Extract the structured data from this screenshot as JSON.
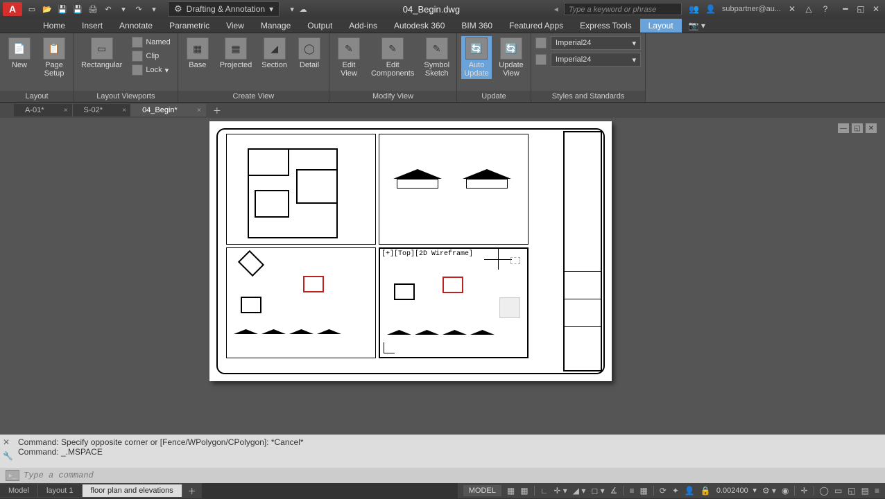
{
  "titlebar": {
    "workspace": "Drafting & Annotation",
    "filename": "04_Begin.dwg",
    "search_placeholder": "Type a keyword or phrase",
    "user": "subpartner@au..."
  },
  "menu": {
    "tabs": [
      "Home",
      "Insert",
      "Annotate",
      "Parametric",
      "View",
      "Manage",
      "Output",
      "Add-ins",
      "Autodesk 360",
      "BIM 360",
      "Featured Apps",
      "Express Tools",
      "Layout"
    ],
    "active": "Layout"
  },
  "ribbon": {
    "panels": [
      {
        "title": "Layout",
        "buttons": [
          {
            "label": "New"
          },
          {
            "label": "Page\nSetup"
          }
        ]
      },
      {
        "title": "Layout Viewports",
        "buttons": [
          {
            "label": "Rectangular"
          }
        ],
        "smalls": [
          "Named",
          "Clip",
          "Lock"
        ]
      },
      {
        "title": "Create View",
        "buttons": [
          {
            "label": "Base"
          },
          {
            "label": "Projected"
          },
          {
            "label": "Section"
          },
          {
            "label": "Detail"
          }
        ]
      },
      {
        "title": "Modify View",
        "buttons": [
          {
            "label": "Edit\nView"
          },
          {
            "label": "Edit\nComponents"
          },
          {
            "label": "Symbol\nSketch"
          }
        ]
      },
      {
        "title": "Update",
        "buttons": [
          {
            "label": "Auto\nUpdate",
            "active": true
          },
          {
            "label": "Update\nView"
          }
        ]
      },
      {
        "title": "Styles and Standards",
        "dropdowns": [
          "Imperial24",
          "Imperial24"
        ]
      }
    ]
  },
  "filetabs": {
    "tabs": [
      {
        "label": "A-01*"
      },
      {
        "label": "S-02*"
      },
      {
        "label": "04_Begin*",
        "active": true
      }
    ]
  },
  "viewport_label": "[+][Top][2D Wireframe]",
  "cmdline": {
    "line1": "Command: Specify opposite corner or [Fence/WPolygon/CPolygon]: *Cancel*",
    "line2": "Command: _.MSPACE",
    "placeholder": "Type a command"
  },
  "bottomtabs": {
    "tabs": [
      {
        "label": "Model"
      },
      {
        "label": "layout 1"
      },
      {
        "label": "floor plan and elevations",
        "active": true
      }
    ]
  },
  "statusbar": {
    "mode": "MODEL",
    "scale": "0.002400"
  }
}
